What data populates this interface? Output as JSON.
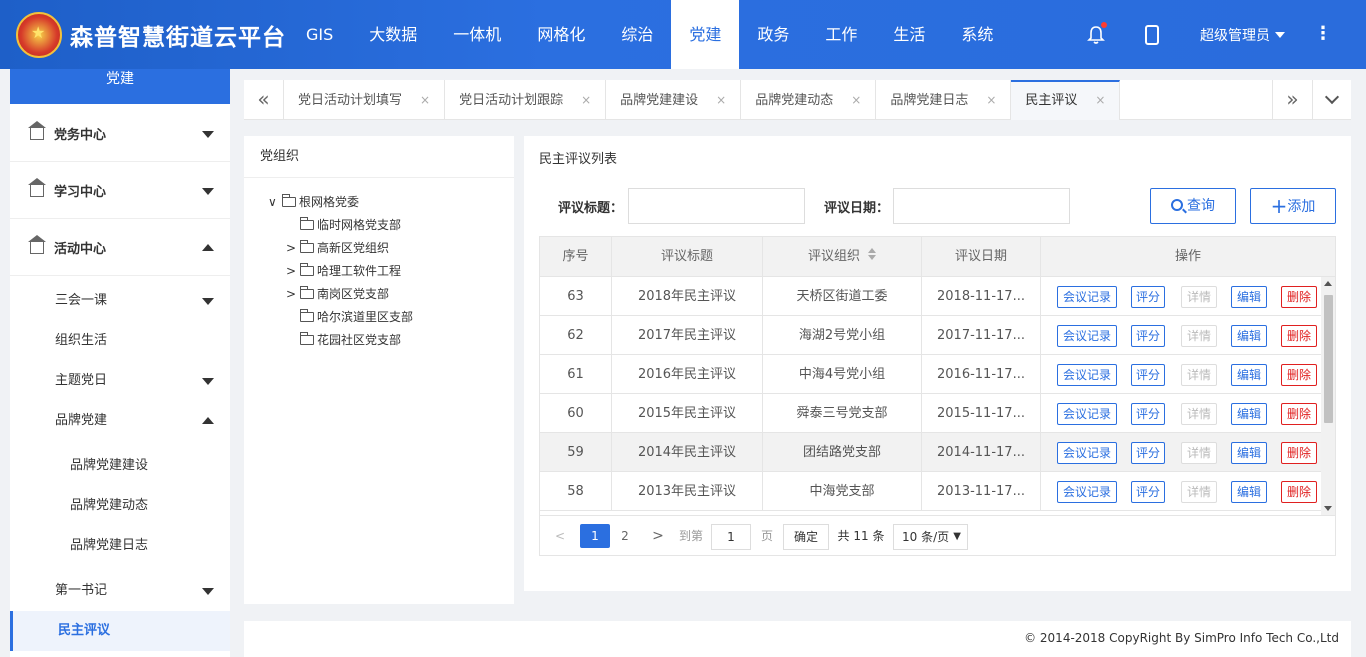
{
  "header": {
    "app_title": "森普智慧街道云平台",
    "nav": [
      "GIS",
      "大数据",
      "一体机",
      "网格化",
      "综治",
      "党建",
      "政务",
      "工作",
      "生活",
      "系统"
    ],
    "active_nav": "党建",
    "user_name": "超级管理员",
    "icons": [
      "emblem-icon",
      "bell-icon",
      "mobile-icon",
      "more-vertical-icon"
    ]
  },
  "sidebar": {
    "top_label": "党建",
    "sections": [
      {
        "label": "党务中心"
      },
      {
        "label": "学习中心"
      },
      {
        "label": "活动中心"
      }
    ],
    "sub_items": [
      "三会一课",
      "组织生活",
      "主题党日",
      "品牌党建"
    ],
    "brand_children": [
      "品牌党建建设",
      "品牌党建动态",
      "品牌党建日志"
    ],
    "after_items": [
      "第一书记",
      "民主评议"
    ],
    "active": "民主评议"
  },
  "tabs": {
    "items": [
      {
        "label": "党日活动计划填写"
      },
      {
        "label": "党日活动计划跟踪"
      },
      {
        "label": "品牌党建建设"
      },
      {
        "label": "品牌党建动态"
      },
      {
        "label": "品牌党建日志"
      },
      {
        "label": "民主评议"
      }
    ],
    "close_glyph": "×",
    "left_glyph": "«",
    "right_glyph": "»"
  },
  "org": {
    "title": "党组织",
    "root": "根网格党委",
    "children": [
      "临时网格党支部",
      "高新区党组织",
      "哈理工软件工程",
      "南岗区党支部",
      "哈尔滨道里区支部",
      "花园社区党支部"
    ]
  },
  "list": {
    "title": "民主评议列表",
    "filter_title_label": "评议标题：",
    "filter_date_label": "评议日期：",
    "filter_title_value": "",
    "filter_date_value": "",
    "search_label": "查询",
    "add_label": "添加",
    "columns": [
      "序号",
      "评议标题",
      "评议组织",
      "评议日期",
      "操作"
    ],
    "rows": [
      {
        "no": "63",
        "title": "2018年民主评议",
        "org": "天桥区街道工委",
        "date": "2018-11-17..."
      },
      {
        "no": "62",
        "title": "2017年民主评议",
        "org": "海湖2号党小组",
        "date": "2017-11-17..."
      },
      {
        "no": "61",
        "title": "2016年民主评议",
        "org": "中海4号党小组",
        "date": "2016-11-17..."
      },
      {
        "no": "60",
        "title": "2015年民主评议",
        "org": "舜泰三号党支部",
        "date": "2015-11-17..."
      },
      {
        "no": "59",
        "title": "2014年民主评议",
        "org": "团结路党支部",
        "date": "2014-11-17..."
      },
      {
        "no": "58",
        "title": "2013年民主评议",
        "org": "中海党支部",
        "date": "2013-11-17..."
      }
    ],
    "actions": [
      "会议记录",
      "评分",
      "详情",
      "编辑",
      "删除"
    ],
    "pager": {
      "pages": [
        "1",
        "2"
      ],
      "current": "1",
      "goto_label": "到第",
      "goto_value": "1",
      "page_unit": "页",
      "confirm": "确定",
      "total": "共 11 条",
      "page_size": "10 条/页"
    }
  },
  "footer": {
    "copyright": "© 2014-2018 CopyRight By SimPro Info Tech Co.,Ltd"
  }
}
